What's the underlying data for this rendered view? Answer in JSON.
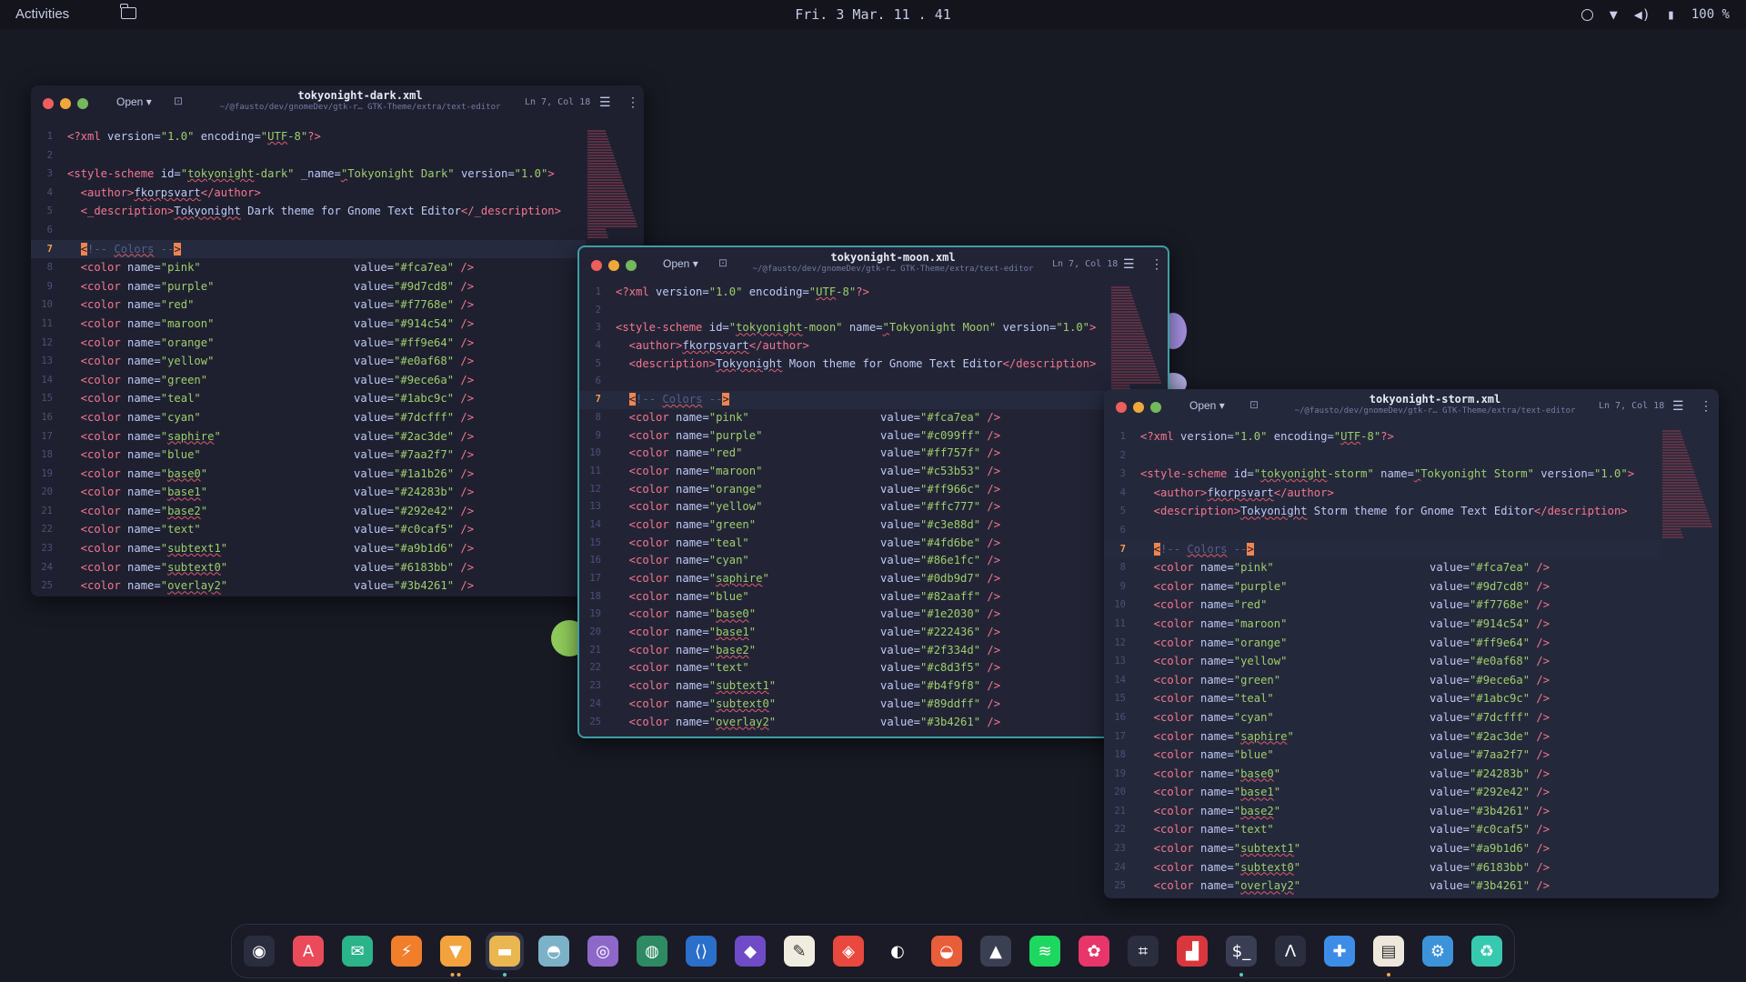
{
  "topbar": {
    "activities": "Activities",
    "clock": "Fri. 3 Mar.  11 . 41",
    "battery": "100 %"
  },
  "editors": [
    {
      "id": "dark",
      "title": "tokyonight-dark.xml",
      "path": "~/@fausto/dev/gnomeDev/gtk-r… GTK-Theme/extra/text-editor",
      "open": "Open",
      "cursor": "Ln 7, Col 18",
      "line1": "<?xml version=\"1.0\" encoding=\"UTF-8\"?>",
      "scheme_id": "tokyonight-dark",
      "scheme_name_attr": "_name",
      "scheme_name": "Tokyonight Dark",
      "author": "fkorpsvart",
      "desc_tag": "_description",
      "desc": "Tokyonight Dark theme for Gnome Text Editor",
      "colors": [
        [
          "pink",
          "#fca7ea"
        ],
        [
          "purple",
          "#9d7cd8"
        ],
        [
          "red",
          "#f7768e"
        ],
        [
          "maroon",
          "#914c54"
        ],
        [
          "orange",
          "#ff9e64"
        ],
        [
          "yellow",
          "#e0af68"
        ],
        [
          "green",
          "#9ece6a"
        ],
        [
          "teal",
          "#1abc9c"
        ],
        [
          "cyan",
          "#7dcfff"
        ],
        [
          "saphire",
          "#2ac3de"
        ],
        [
          "blue",
          "#7aa2f7"
        ],
        [
          "base0",
          "#1a1b26"
        ],
        [
          "base1",
          "#24283b"
        ],
        [
          "base2",
          "#292e42"
        ],
        [
          "text",
          "#c0caf5"
        ],
        [
          "subtext1",
          "#a9b1d6"
        ],
        [
          "subtext0",
          "#6183bb"
        ],
        [
          "overlay2",
          "#3b4261"
        ]
      ]
    },
    {
      "id": "moon",
      "title": "tokyonight-moon.xml",
      "path": "~/@fausto/dev/gnomeDev/gtk-r… GTK-Theme/extra/text-editor",
      "open": "Open",
      "cursor": "Ln 7, Col 18",
      "line1": "<?xml version=\"1.0\" encoding=\"UTF-8\"?>",
      "scheme_id": "tokyonight-moon",
      "scheme_name_attr": "name",
      "scheme_name": "Tokyonight Moon",
      "author": "fkorpsvart",
      "desc_tag": "description",
      "desc": "Tokyonight Moon theme for Gnome Text Editor",
      "colors": [
        [
          "pink",
          "#fca7ea"
        ],
        [
          "purple",
          "#c099ff"
        ],
        [
          "red",
          "#ff757f"
        ],
        [
          "maroon",
          "#c53b53"
        ],
        [
          "orange",
          "#ff966c"
        ],
        [
          "yellow",
          "#ffc777"
        ],
        [
          "green",
          "#c3e88d"
        ],
        [
          "teal",
          "#4fd6be"
        ],
        [
          "cyan",
          "#86e1fc"
        ],
        [
          "saphire",
          "#0db9d7"
        ],
        [
          "blue",
          "#82aaff"
        ],
        [
          "base0",
          "#1e2030"
        ],
        [
          "base1",
          "#222436"
        ],
        [
          "base2",
          "#2f334d"
        ],
        [
          "text",
          "#c8d3f5"
        ],
        [
          "subtext1",
          "#b4f9f8"
        ],
        [
          "subtext0",
          "#89ddff"
        ],
        [
          "overlay2",
          "#3b4261"
        ]
      ]
    },
    {
      "id": "storm",
      "title": "tokyonight-storm.xml",
      "path": "~/@fausto/dev/gnomeDev/gtk-r… GTK-Theme/extra/text-editor",
      "open": "Open",
      "cursor": "Ln 7, Col 18",
      "line1": "<?xml version=\"1.0\" encoding=\"UTF-8\"?>",
      "scheme_id": "tokyonight-storm",
      "scheme_name_attr": "name",
      "scheme_name": "Tokyonight Storm",
      "author": "fkorpsvart",
      "desc_tag": "description",
      "desc": "Tokyonight Storm theme for Gnome Text Editor",
      "colors": [
        [
          "pink",
          "#fca7ea"
        ],
        [
          "purple",
          "#9d7cd8"
        ],
        [
          "red",
          "#f7768e"
        ],
        [
          "maroon",
          "#914c54"
        ],
        [
          "orange",
          "#ff9e64"
        ],
        [
          "yellow",
          "#e0af68"
        ],
        [
          "green",
          "#9ece6a"
        ],
        [
          "teal",
          "#1abc9c"
        ],
        [
          "cyan",
          "#7dcfff"
        ],
        [
          "saphire",
          "#2ac3de"
        ],
        [
          "blue",
          "#7aa2f7"
        ],
        [
          "base0",
          "#24283b"
        ],
        [
          "base1",
          "#292e42"
        ],
        [
          "base2",
          "#3b4261"
        ],
        [
          "text",
          "#c0caf5"
        ],
        [
          "subtext1",
          "#a9b1d6"
        ],
        [
          "subtext0",
          "#6183bb"
        ],
        [
          "overlay2",
          "#3b4261"
        ]
      ]
    }
  ],
  "comment": "Colors",
  "dock": [
    {
      "name": "ulauncher",
      "icon": "penguin-icon",
      "glyph": "◉",
      "bg": "#2a2d3e"
    },
    {
      "name": "app-store",
      "icon": "app-store-icon",
      "glyph": "A",
      "bg": "#ea4b5b"
    },
    {
      "name": "mail",
      "icon": "mail-icon",
      "glyph": "✉",
      "bg": "#2bb38a"
    },
    {
      "name": "bolt",
      "icon": "bolt-icon",
      "glyph": "⚡",
      "bg": "#f07e2a"
    },
    {
      "name": "brave",
      "icon": "brave-icon",
      "glyph": "▼",
      "bg": "#f2a33d",
      "running": 2
    },
    {
      "name": "files",
      "icon": "folder-icon",
      "glyph": "▬",
      "bg": "#e9b64f",
      "active": true,
      "running": 1
    },
    {
      "name": "disks",
      "icon": "dome-icon",
      "glyph": "◓",
      "bg": "#7cb2c7"
    },
    {
      "name": "github",
      "icon": "github-icon",
      "glyph": "◎",
      "bg": "#8e68c9"
    },
    {
      "name": "world",
      "icon": "globe-icon",
      "glyph": "◍",
      "bg": "#2e8a62"
    },
    {
      "name": "vscode",
      "icon": "vscode-icon",
      "glyph": "⟨⟩",
      "bg": "#2a6fc9"
    },
    {
      "name": "obsidian",
      "icon": "crystal-icon",
      "glyph": "◆",
      "bg": "#6f4bc8"
    },
    {
      "name": "text-editor",
      "icon": "pencil-icon",
      "glyph": "✎",
      "bg": "#f0ece0"
    },
    {
      "name": "color-picker",
      "icon": "drop-icon",
      "glyph": "◈",
      "bg": "#e8483e"
    },
    {
      "name": "figma",
      "icon": "figma-icon",
      "glyph": "◐",
      "bg": "#1a1b26"
    },
    {
      "name": "firefox",
      "icon": "firefox-icon",
      "glyph": "◒",
      "bg": "#e85d3a"
    },
    {
      "name": "inkscape",
      "icon": "ink-icon",
      "glyph": "▲",
      "bg": "#3b3f52"
    },
    {
      "name": "spotify",
      "icon": "spotify-icon",
      "glyph": "≋",
      "bg": "#1ed760"
    },
    {
      "name": "shortwave",
      "icon": "flower-icon",
      "glyph": "✿",
      "bg": "#e8356a"
    },
    {
      "name": "screenshot",
      "icon": "crop-icon",
      "glyph": "⌗",
      "bg": "#2b2e3f"
    },
    {
      "name": "soundwave",
      "icon": "waves-icon",
      "glyph": "▟",
      "bg": "#d9363e"
    },
    {
      "name": "terminal",
      "icon": "terminal-icon",
      "glyph": "$_",
      "bg": "#3a3e55",
      "running": 1
    },
    {
      "name": "alacritty",
      "icon": "alacritty-icon",
      "glyph": "Λ",
      "bg": "#2b2e3f"
    },
    {
      "name": "extensions",
      "icon": "puzzle-icon",
      "glyph": "✚",
      "bg": "#3d8de8"
    },
    {
      "name": "tweaks",
      "icon": "tweaks-icon",
      "glyph": "▤",
      "bg": "#eee7dc",
      "running": 1
    },
    {
      "name": "settings",
      "icon": "gear-icon",
      "glyph": "⚙",
      "bg": "#3d93d9"
    },
    {
      "name": "trash",
      "icon": "trash-icon",
      "glyph": "♻",
      "bg": "#36c9b0"
    }
  ]
}
